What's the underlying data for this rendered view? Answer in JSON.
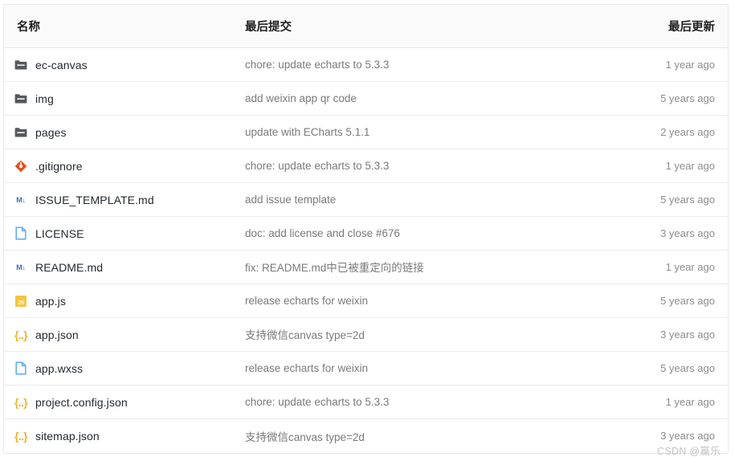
{
  "table": {
    "headers": {
      "name": "名称",
      "commit": "最后提交",
      "updated": "最后更新"
    },
    "rows": [
      {
        "icon": "folder-icon",
        "name": "ec-canvas",
        "commit": "chore: update echarts to 5.3.3",
        "updated": "1 year ago"
      },
      {
        "icon": "folder-icon",
        "name": "img",
        "commit": "add weixin app qr code",
        "updated": "5 years ago"
      },
      {
        "icon": "folder-icon",
        "name": "pages",
        "commit": "update with ECharts 5.1.1",
        "updated": "2 years ago"
      },
      {
        "icon": "git-icon",
        "name": ".gitignore",
        "commit": "chore: update echarts to 5.3.3",
        "updated": "1 year ago"
      },
      {
        "icon": "markdown-icon",
        "name": "ISSUE_TEMPLATE.md",
        "commit": "add issue template",
        "updated": "5 years ago"
      },
      {
        "icon": "document-icon",
        "name": "LICENSE",
        "commit": "doc: add license and close #676",
        "updated": "3 years ago"
      },
      {
        "icon": "markdown-icon",
        "name": "README.md",
        "commit": "fix: README.md中已被重定向的链接",
        "updated": "1 year ago"
      },
      {
        "icon": "javascript-icon",
        "name": "app.js",
        "commit": "release echarts for weixin",
        "updated": "5 years ago"
      },
      {
        "icon": "json-icon",
        "name": "app.json",
        "commit": "支持微信canvas type=2d",
        "updated": "3 years ago"
      },
      {
        "icon": "document-icon",
        "name": "app.wxss",
        "commit": "release echarts for weixin",
        "updated": "5 years ago"
      },
      {
        "icon": "json-icon",
        "name": "project.config.json",
        "commit": "chore: update echarts to 5.3.3",
        "updated": "1 year ago"
      },
      {
        "icon": "json-icon",
        "name": "sitemap.json",
        "commit": "支持微信canvas type=2d",
        "updated": "3 years ago"
      }
    ]
  },
  "watermark": "CSDN @赢乐",
  "colors": {
    "folder": "#55595c",
    "git": "#e8501f",
    "markdown": "#3572b0",
    "document": "#5aaaf5",
    "javascript": "#f5c542",
    "json": "#f0b429",
    "header_bg": "#fafafa",
    "border": "#e8e8e8",
    "name_text": "#24292e",
    "commit_text": "#7a7a7a",
    "time_text": "#8c8c8c"
  },
  "icon_glyphs": {
    "javascript_label": "JS",
    "json_label": "{..}",
    "markdown_label": "M↓"
  }
}
